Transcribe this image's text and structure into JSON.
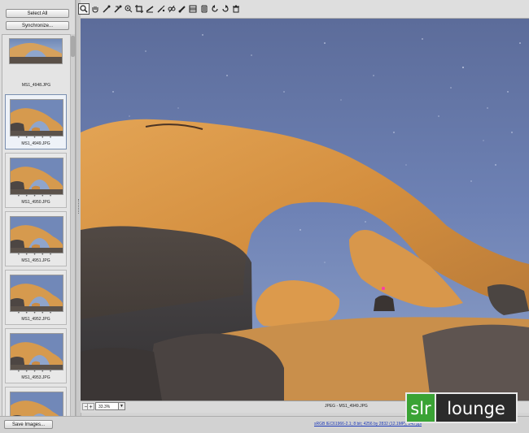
{
  "left_panel": {
    "select_all_label": "Select All",
    "synchronize_label": "Synchronize...",
    "save_images_label": "Save Images..."
  },
  "filmstrip": {
    "top_partial": {
      "filename": "MS1_4948.JPG"
    },
    "thumbnails": [
      {
        "filename": "MS1_4949.JPG",
        "selected": true,
        "dots": "• • • • •"
      },
      {
        "filename": "MS1_4950.JPG",
        "selected": false,
        "dots": "• • • • •"
      },
      {
        "filename": "MS1_4951.JPG",
        "selected": false,
        "dots": "• • • • •"
      },
      {
        "filename": "MS1_4952.JPG",
        "selected": false,
        "dots": "• • • • •"
      },
      {
        "filename": "MS1_4953.JPG",
        "selected": false,
        "dots": "• • • • •"
      }
    ]
  },
  "toolbar": {
    "tools": [
      "zoom-icon",
      "hand-icon",
      "white-balance-icon",
      "color-sampler-icon",
      "target-adjustment-icon",
      "crop-icon",
      "straighten-icon",
      "spot-removal-icon",
      "red-eye-icon",
      "adjustment-brush-icon",
      "graduated-filter-icon",
      "preferences-icon",
      "rotate-left-icon",
      "rotate-right-icon",
      "trash-icon"
    ]
  },
  "statusbar": {
    "zoom_value": "33.3%",
    "file_info": "JPEG - MS1_4949.JPG"
  },
  "bottombar": {
    "workflow_options": "sRGB IEC61966-2.1; 8 bit; 4256 by 2832 (12.1MP); 240 ppi"
  },
  "watermark": {
    "left": "slr",
    "right": "lounge",
    "green": "#3aa335",
    "dark": "#2b2b2b"
  },
  "colors": {
    "sky": "#5b6f9e",
    "rock": "#d99a4a",
    "shadow": "#3f3b3a"
  }
}
